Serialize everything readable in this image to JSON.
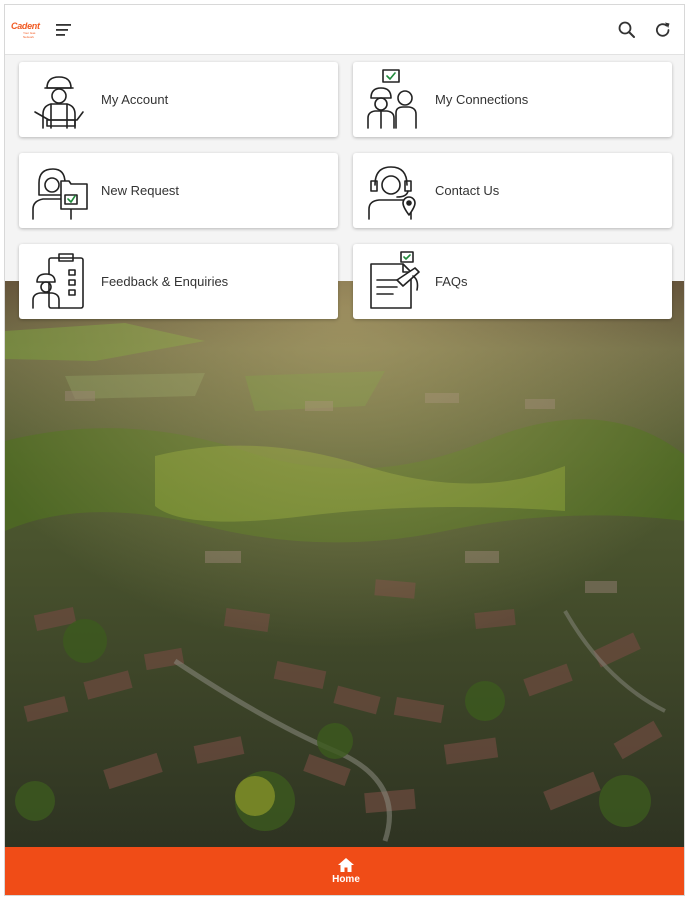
{
  "header": {
    "logo_text": "Cadent",
    "logo_subtext": "Your Gas Network",
    "menu_icon": "hamburger-menu-icon",
    "search_icon": "search-icon",
    "refresh_icon": "refresh-icon"
  },
  "tiles": [
    {
      "label": "My Account",
      "icon": "engineer-laptop-icon"
    },
    {
      "label": "My Connections",
      "icon": "engineers-check-icon"
    },
    {
      "label": "New Request",
      "icon": "person-folder-icon"
    },
    {
      "label": "Contact Us",
      "icon": "headset-location-icon"
    },
    {
      "label": "Feedback & Enquiries",
      "icon": "clipboard-engineer-icon"
    },
    {
      "label": "FAQs",
      "icon": "document-pen-icon"
    }
  ],
  "bottom_nav": {
    "home_label": "Home",
    "home_icon": "home-icon"
  },
  "colors": {
    "accent": "#f04c17",
    "card": "#ffffff",
    "text": "#333333"
  }
}
